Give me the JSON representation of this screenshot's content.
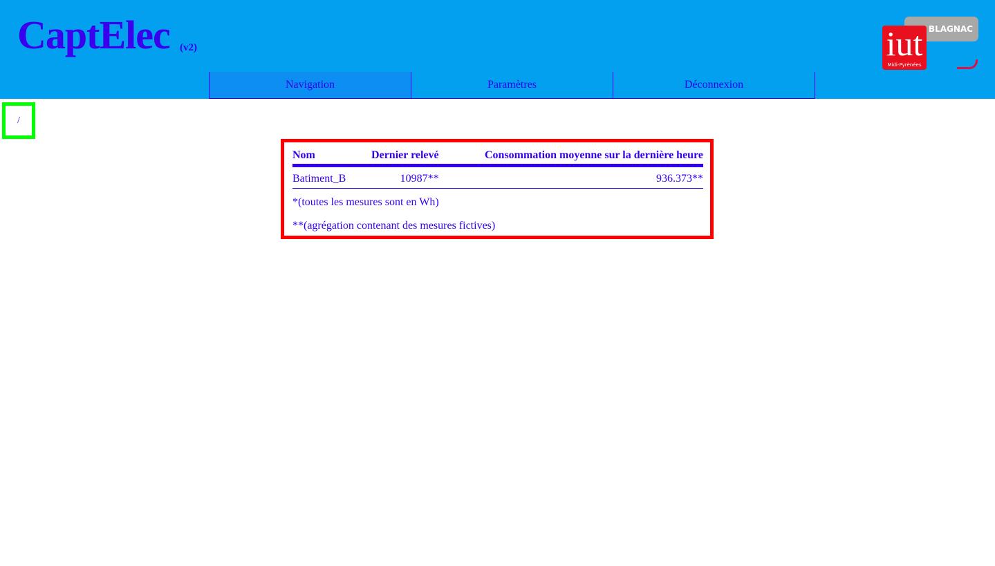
{
  "header": {
    "title": "CaptElec",
    "version": "(v2)",
    "logo": {
      "badge_text": "BLAGNAC",
      "main_text": "iut",
      "sub_text": "Midi-Pyrénées"
    }
  },
  "nav": {
    "items": [
      {
        "label": "Navigation",
        "active": true
      },
      {
        "label": "Paramètres",
        "active": false
      },
      {
        "label": "Déconnexion",
        "active": false
      }
    ]
  },
  "breadcrumb": {
    "path": "/"
  },
  "table": {
    "columns": [
      "Nom",
      "Dernier relevé",
      "Consommation moyenne sur la dernière heure"
    ],
    "rows": [
      [
        "Batiment_B",
        "10987**",
        "936.373**"
      ]
    ]
  },
  "notes": [
    "*(toutes les mesures sont en Wh)",
    "**(agrégation contenant des mesures fictives)"
  ],
  "colors": {
    "header_bg": "#03a0ef",
    "text": "#3300ee",
    "nav_active": "#0c8ef2",
    "panel_border": "#ff0000",
    "breadcrumb_border": "#00ff00"
  }
}
